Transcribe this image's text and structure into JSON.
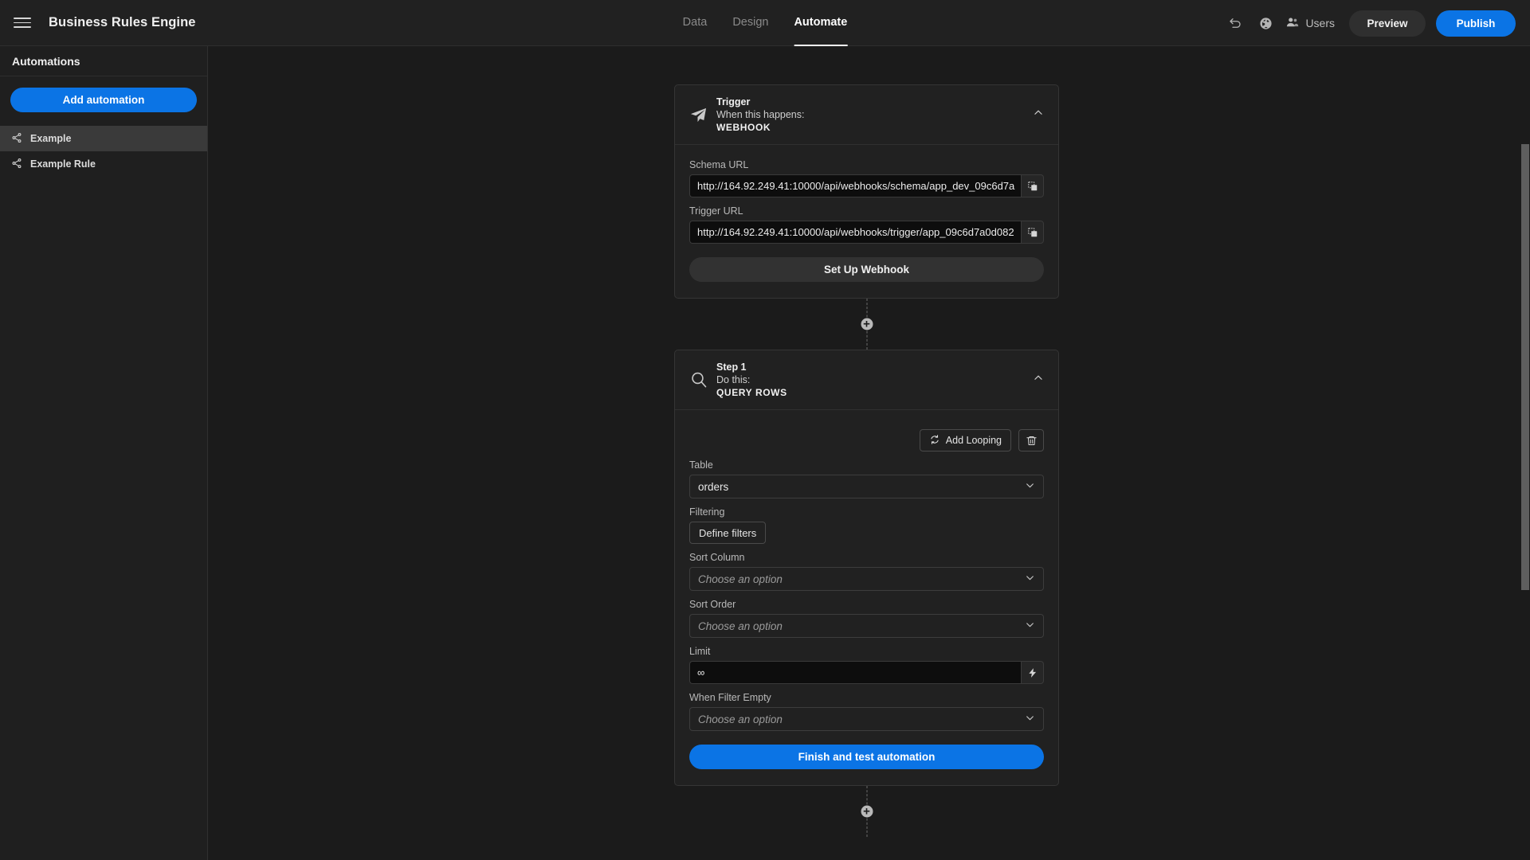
{
  "header": {
    "menu_icon": "hamburger-icon",
    "title": "Business Rules Engine",
    "tabs": [
      {
        "label": "Data",
        "active": false
      },
      {
        "label": "Design",
        "active": false
      },
      {
        "label": "Automate",
        "active": true
      }
    ],
    "undo_icon": "undo-icon",
    "globe_icon": "globe-icon",
    "users_icon": "users-icon",
    "users_label": "Users",
    "preview_label": "Preview",
    "publish_label": "Publish",
    "publish_color": "#0b74e5"
  },
  "sidebar": {
    "heading": "Automations",
    "add_button": "Add automation",
    "items": [
      {
        "label": "Example",
        "icon": "share-nodes-icon",
        "selected": true
      },
      {
        "label": "Example Rule",
        "icon": "share-nodes-icon",
        "selected": false
      }
    ]
  },
  "flow": {
    "trigger": {
      "icon": "paper-plane-icon",
      "title": "Trigger",
      "subtitle": "When this happens:",
      "type": "WEBHOOK",
      "collapse_icon": "chevron-up-icon",
      "schema_url_label": "Schema URL",
      "schema_url_value": "http://164.92.249.41:10000/api/webhooks/schema/app_dev_09c6d7a",
      "trigger_url_label": "Trigger URL",
      "trigger_url_value": "http://164.92.249.41:10000/api/webhooks/trigger/app_09c6d7a0d082",
      "copy_icon": "copy-icon",
      "setup_button": "Set Up Webhook"
    },
    "connector_add_icon": "plus-circle-icon",
    "step1": {
      "icon": "magnifier-icon",
      "title": "Step 1",
      "subtitle": "Do this:",
      "type": "QUERY ROWS",
      "collapse_icon": "chevron-up-icon",
      "add_looping_label": "Add Looping",
      "add_looping_icon": "loop-icon",
      "delete_icon": "trash-icon",
      "table_label": "Table",
      "table_value": "orders",
      "filtering_label": "Filtering",
      "define_filters_label": "Define filters",
      "sort_column_label": "Sort Column",
      "sort_column_value": "Choose an option",
      "sort_order_label": "Sort Order",
      "sort_order_value": "Choose an option",
      "limit_label": "Limit",
      "limit_value": "∞",
      "binding_icon": "lightning-icon",
      "when_filter_empty_label": "When Filter Empty",
      "when_filter_empty_value": "Choose an option",
      "finish_button": "Finish and test automation",
      "caret_icon": "chevron-down-icon"
    }
  }
}
